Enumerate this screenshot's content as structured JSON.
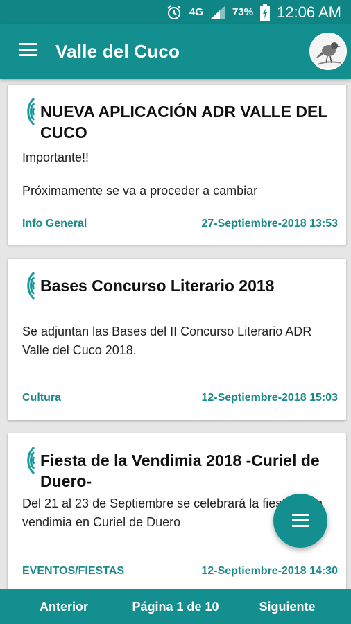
{
  "status_bar": {
    "network": "4G",
    "battery": "73%",
    "time": "12:06 AM",
    "icons": [
      "alarm-icon",
      "signal-icon",
      "battery-icon"
    ]
  },
  "app_bar": {
    "title": "Valle del Cuco",
    "menu_icon": "hamburger-menu-icon",
    "avatar": "bird-avatar"
  },
  "cards": [
    {
      "icon": "broadcast-icon",
      "title": "NUEVA APLICACIÓN ADR VALLE DEL CUCO",
      "body_lines": [
        "Importante!!",
        "Próximamente se va a proceder a cambiar"
      ],
      "category": "Info General",
      "date": "27-Septiembre-2018 13:53"
    },
    {
      "icon": "broadcast-icon",
      "title": "Bases Concurso Literario 2018",
      "body_lines": [
        "Se adjuntan las Bases del II Concurso Literario ADR Valle del Cuco 2018."
      ],
      "category": "Cultura",
      "date": "12-Septiembre-2018 15:03"
    },
    {
      "icon": "broadcast-icon",
      "title": "Fiesta de la Vendimia 2018 -Curiel de Duero-",
      "body_lines": [
        "Del 21 al 23 de Septiembre se celebrará la fiesta de la vendimia en Curiel de Duero"
      ],
      "category": "EVENTOS/FIESTAS",
      "date": "12-Septiembre-2018 14:30"
    }
  ],
  "fab": {
    "icon": "list-icon"
  },
  "pagination": {
    "prev_label": "Anterior",
    "page_label": "Página 1 de 10",
    "next_label": "Siguiente"
  },
  "colors": {
    "primary": "#138f8f",
    "status_bar": "#0f8585",
    "accent_text": "#1b8a8a",
    "background": "#e6e6e6"
  }
}
